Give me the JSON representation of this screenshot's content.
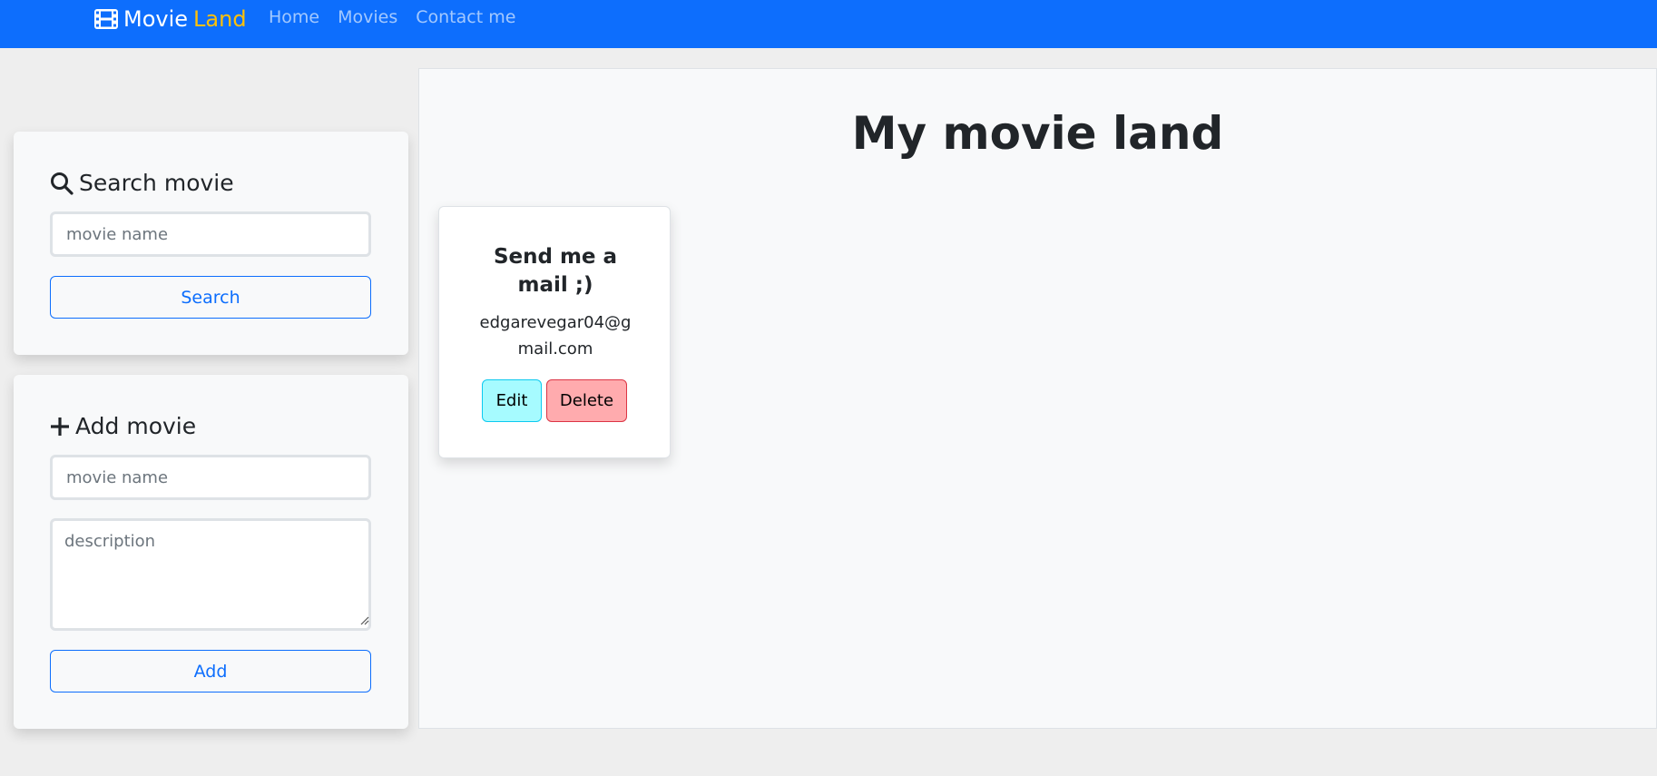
{
  "navbar": {
    "brand_main": "Movie",
    "brand_accent": "Land",
    "links": [
      "Home",
      "Movies",
      "Contact me"
    ]
  },
  "search_panel": {
    "title": "Search movie",
    "input_placeholder": "movie name",
    "button_label": "Search"
  },
  "add_panel": {
    "title": "Add movie",
    "name_placeholder": "movie name",
    "description_placeholder": "description",
    "button_label": "Add"
  },
  "main": {
    "title": "My movie land"
  },
  "movie_card": {
    "title": "Send me a mail ;)",
    "description": "edgarevegar04@gmail.com",
    "edit_label": "Edit",
    "delete_label": "Delete"
  },
  "colors": {
    "navbar": "#0d6efd",
    "brand_accent": "#ffc107",
    "edit_button": "#a6fbff",
    "delete_button": "#ffabae"
  }
}
